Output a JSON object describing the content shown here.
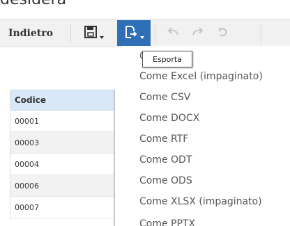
{
  "page": {
    "partial_heading": "desidera"
  },
  "toolbar": {
    "back_label": "Indietro",
    "icons": {
      "save": "floppy-disk-icon",
      "export": "export-document-icon",
      "undo": "undo-icon",
      "redo": "redo-icon",
      "refresh": "refresh-icon"
    },
    "colors": {
      "active_button": "#2f6fb5"
    }
  },
  "grid": {
    "header": "Codice",
    "rows": [
      "00001",
      "00003",
      "00004",
      "00006",
      "00007"
    ]
  },
  "export_menu": {
    "tooltip": "Esporta",
    "first_item_visible": "C",
    "items": [
      "Come Excel (impaginato)",
      "Come CSV",
      "Come DOCX",
      "Come RTF",
      "Come ODT",
      "Come ODS",
      "Come XLSX (impaginato)",
      "Come PPTX"
    ]
  }
}
